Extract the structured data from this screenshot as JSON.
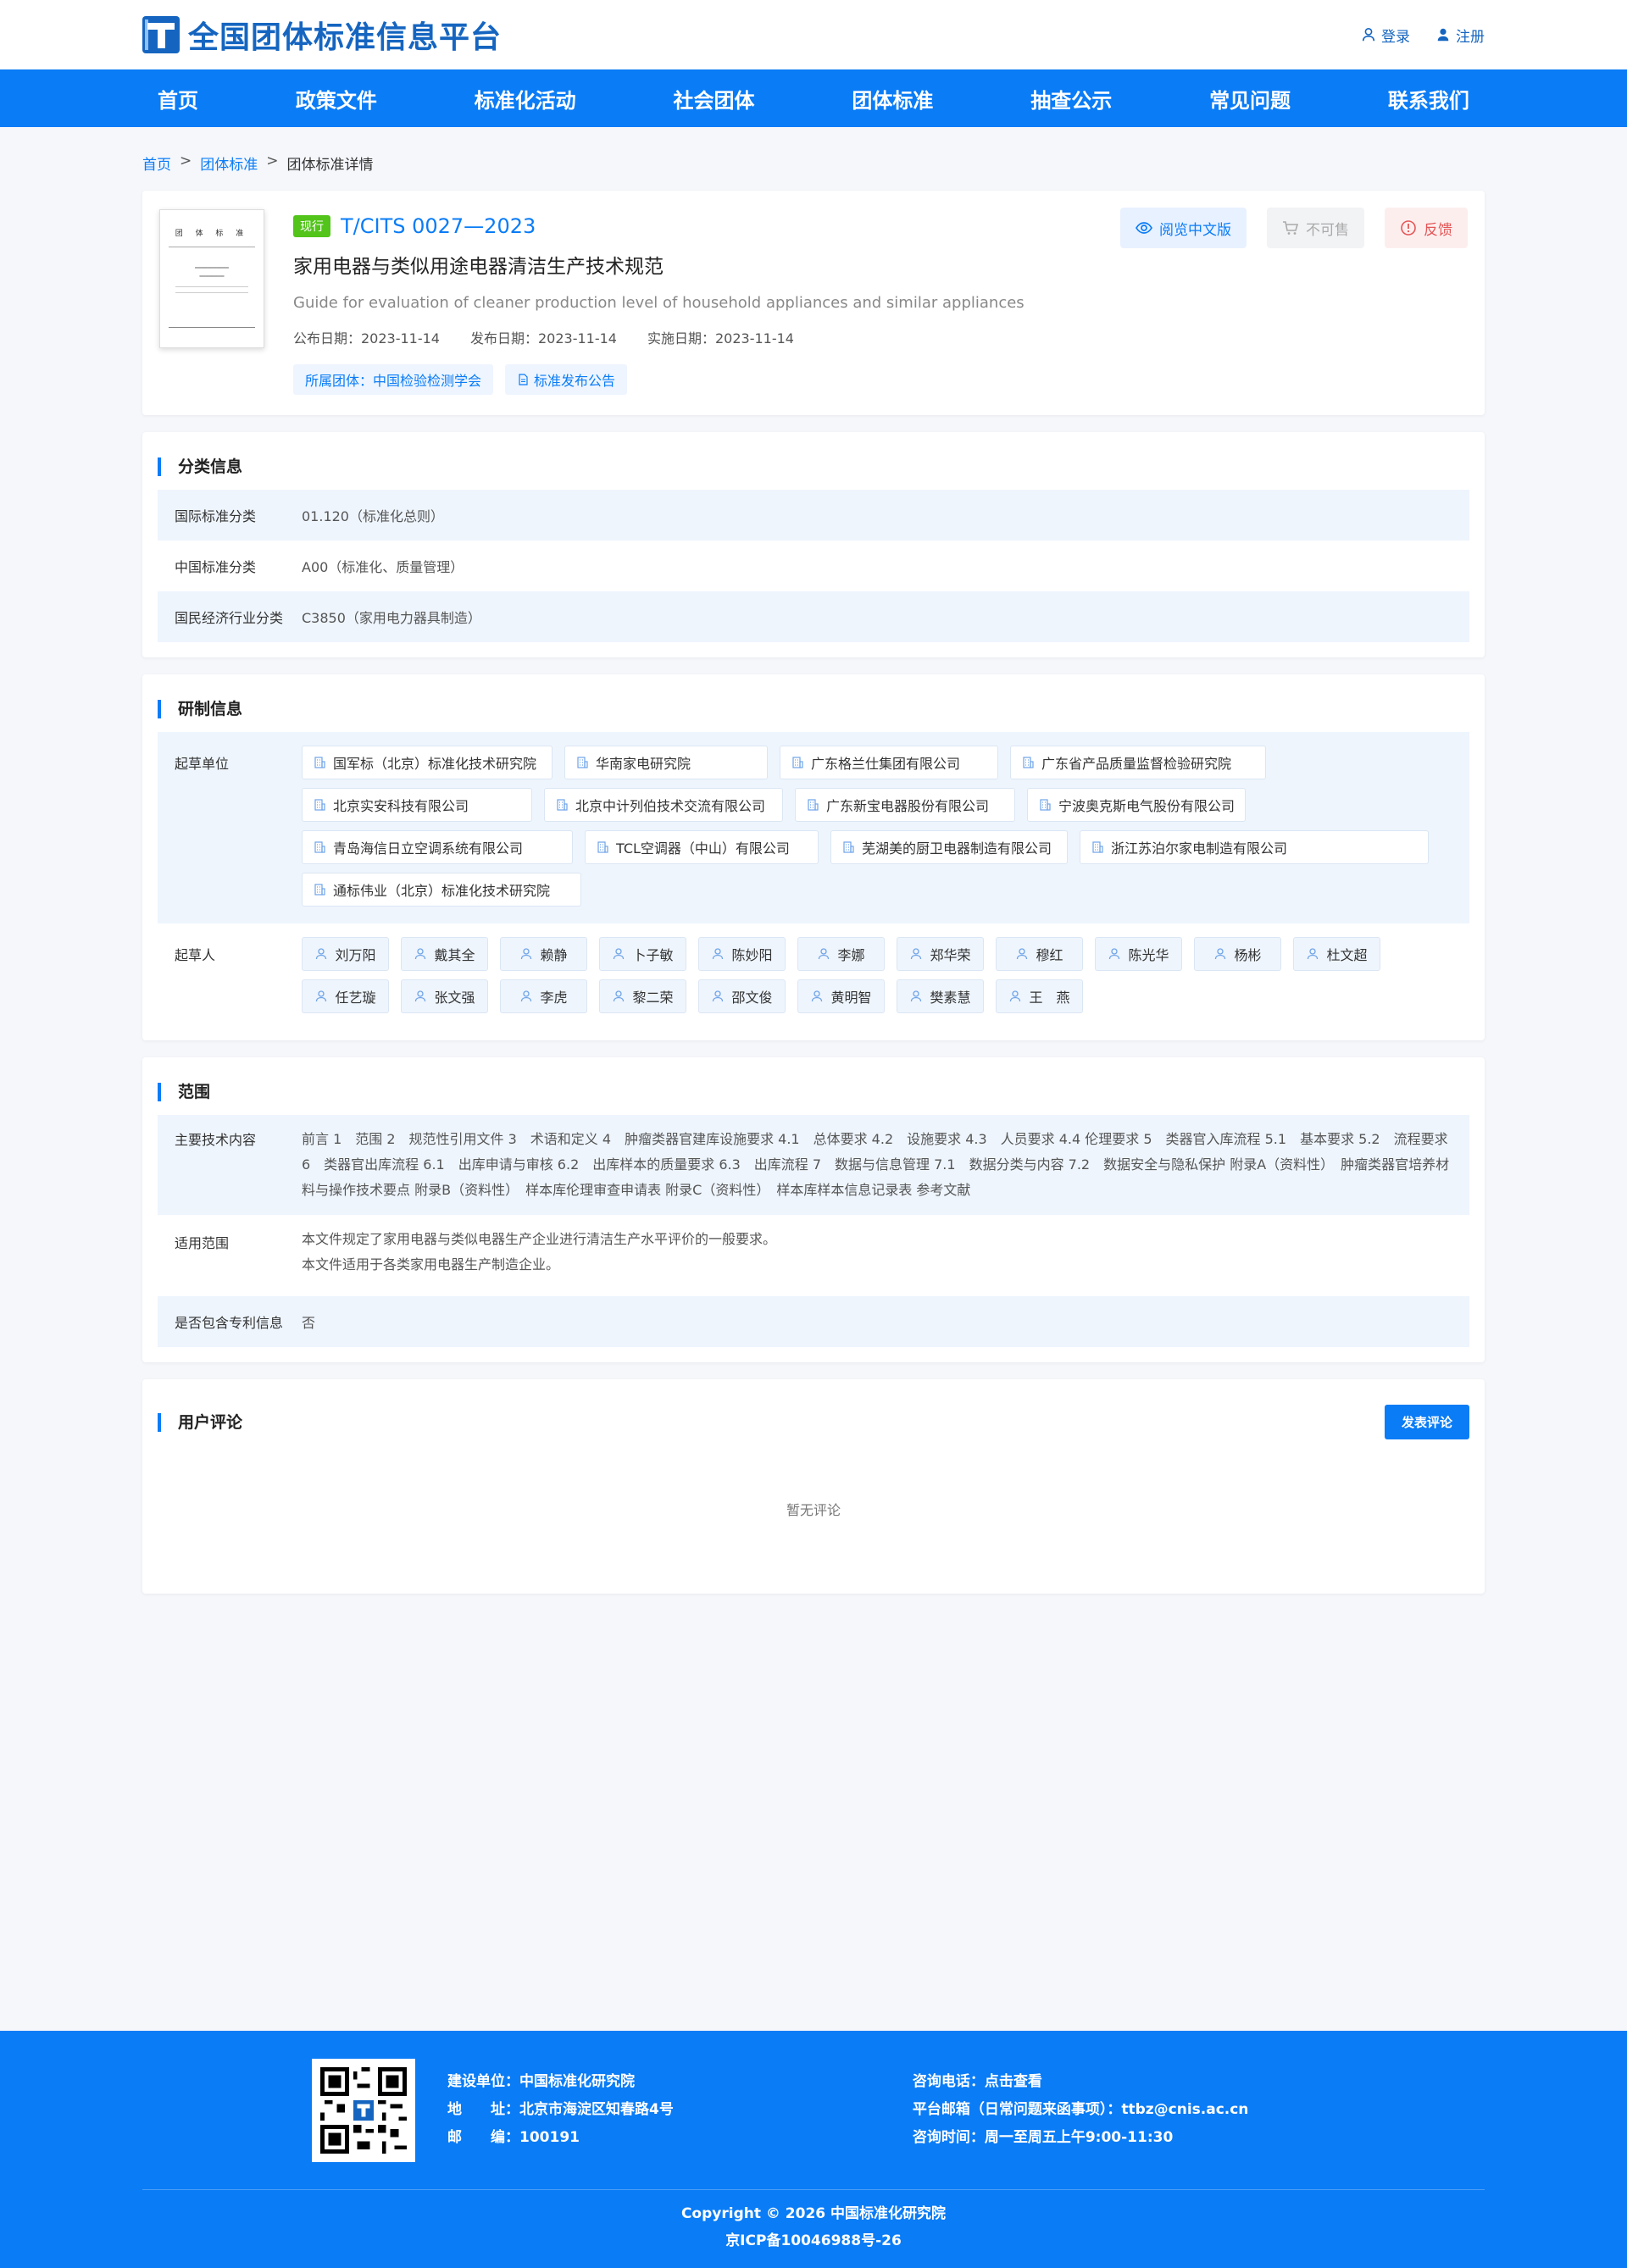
{
  "site": {
    "logo_text": "全国团体标准信息平台",
    "login": "登录",
    "register": "注册",
    "accent": "#0a7cf6"
  },
  "nav": [
    "首页",
    "政策文件",
    "标准化活动",
    "社会团体",
    "团体标准",
    "抽查公示",
    "常见问题",
    "联系我们"
  ],
  "breadcrumb": {
    "home": "首页",
    "group": "团体标准",
    "current": "团体标准详情",
    "sep": ">"
  },
  "detail": {
    "status": "现行",
    "code": "T/CITS 0027—2023",
    "title": "家用电器与类似用途电器清洁生产技术规范",
    "title_en": "Guide for evaluation of cleaner production level of household appliances and similar appliances",
    "publish_date": "公布日期：2023-11-14",
    "issue_date": "发布日期：2023-11-14",
    "impl_date": "实施日期：2023-11-14",
    "org_tag": "所属团体：中国检验检测学会",
    "notice_tag": "标准发布公告",
    "read_btn": "阅览中文版",
    "nosale_btn": "不可售",
    "feedback_btn": "反馈",
    "cover_head": "团 体 标 准"
  },
  "classification": {
    "title": "分类信息",
    "rows": [
      {
        "label": "国际标准分类",
        "value": "01.120（标准化总则）"
      },
      {
        "label": "中国标准分类",
        "value": "A00（标准化、质量管理）"
      },
      {
        "label": "国民经济行业分类",
        "value": "C3850（家用电力器具制造）"
      }
    ]
  },
  "development": {
    "title": "研制信息",
    "units_label": "起草单位",
    "units": [
      "国军标（北京）标准化技术研究院",
      "华南家电研究院",
      "广东格兰仕集团有限公司",
      "广东省产品质量监督检验研究院",
      "北京实安科技有限公司",
      "北京中计列伯技术交流有限公司",
      "广东新宝电器股份有限公司",
      "宁波奥克斯电气股份有限公司",
      "青岛海信日立空调系统有限公司",
      "TCL空调器（中山）有限公司",
      "芜湖美的厨卫电器制造有限公司",
      "浙江苏泊尔家电制造有限公司",
      "通标伟业（北京）标准化技术研究院"
    ],
    "persons_label": "起草人",
    "persons": [
      "刘万阳",
      "戴其全",
      "赖静",
      "卜子敏",
      "陈妙阳",
      "李娜",
      "郑华荣",
      "穆红",
      "陈光华",
      "杨彬",
      "杜文超",
      "任艺璇",
      "张文强",
      "李虎",
      "黎二荣",
      "邵文俊",
      "黄明智",
      "樊素慧",
      "王　燕"
    ]
  },
  "scope": {
    "title": "范围",
    "tech_label": "主要技术内容",
    "tech_content": "前言 1　范围 2　规范性引用文件 3　术语和定义 4　肿瘤类器官建库设施要求 4.1　总体要求 4.2　设施要求 4.3　人员要求 4.4 伦理要求 5　类器官入库流程 5.1　基本要求 5.2　流程要求 6　类器官出库流程 6.1　出库申请与审核 6.2　出库样本的质量要求 6.3　出库流程 7　数据与信息管理 7.1　数据分类与内容 7.2　数据安全与隐私保护 附录A（资料性）　肿瘤类器官培养材料与操作技术要点 附录B（资料性）　样本库伦理审查申请表 附录C（资料性）　样本库样本信息记录表 参考文献",
    "scope_label": "适用范围",
    "scope_line1": "本文件规定了家用电器与类似电器生产企业进行清洁生产水平评价的一般要求。",
    "scope_line2": "本文件适用于各类家用电器生产制造企业。",
    "patent_label": "是否包含专利信息",
    "patent_value": "否"
  },
  "comments": {
    "title": "用户评论",
    "post_btn": "发表评论",
    "empty": "暂无评论"
  },
  "footer": {
    "builder": "建设单位：中国标准化研究院",
    "address": "地　　址：北京市海淀区知春路4号",
    "postcode": "邮　　编：100191",
    "phone": "咨询电话：点击查看",
    "email": "平台邮箱（日常问题来函事项）：ttbz@cnis.ac.cn",
    "hours": "咨询时间：周一至周五上午9:00-11:30",
    "copyright": "Copyright © 2026 中国标准化研究院",
    "icp": "京ICP备10046988号-26"
  }
}
